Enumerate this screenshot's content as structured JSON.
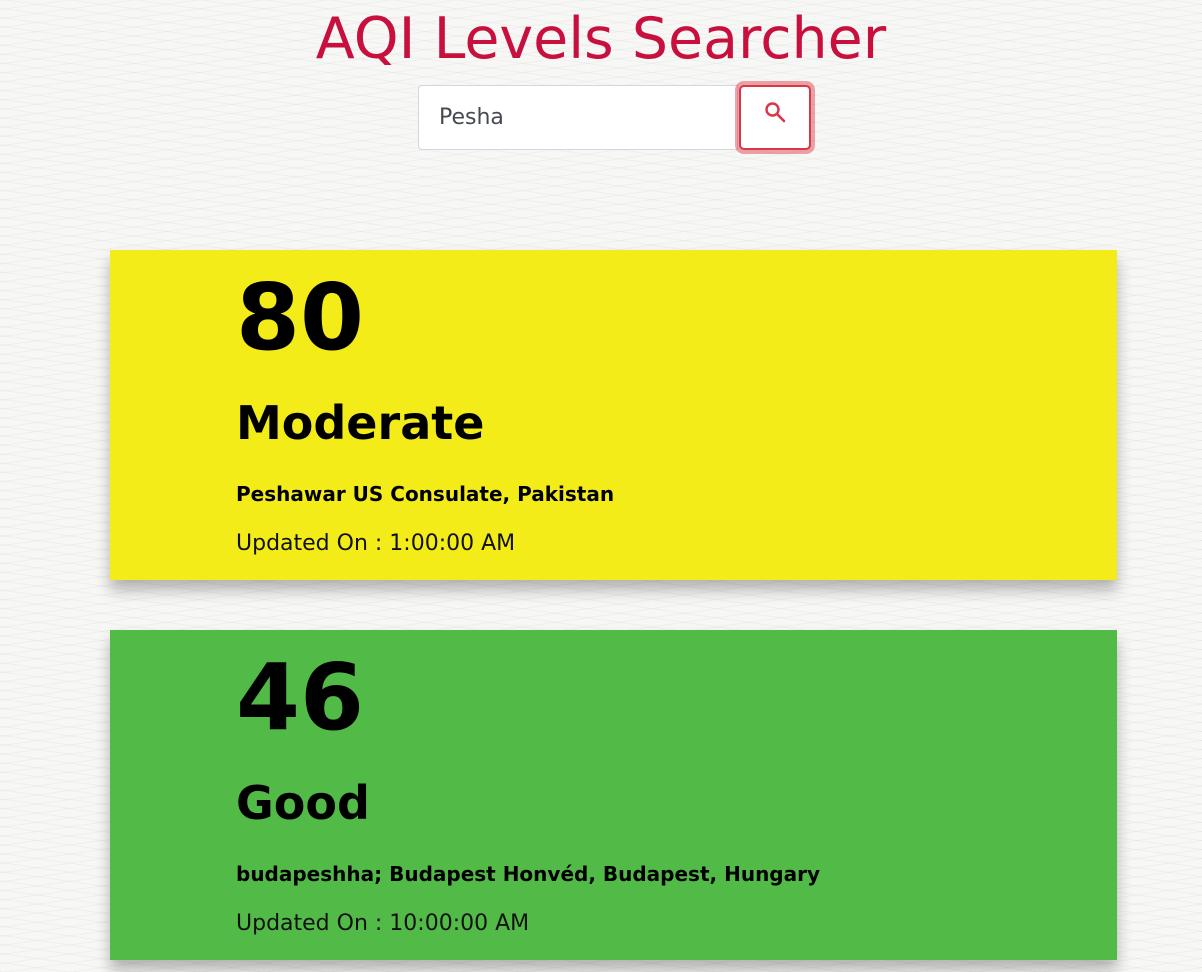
{
  "page": {
    "title": "AQI Levels Searcher",
    "title_color": "#c8103e"
  },
  "search": {
    "value": "Pesha",
    "button_icon": "search-icon",
    "accent_color": "#dc3545"
  },
  "results": [
    {
      "aqi": "80",
      "level": "Moderate",
      "station": "Peshawar US Consulate, Pakistan",
      "updated": "Updated On : 1:00:00 AM",
      "color": "#f3ec19"
    },
    {
      "aqi": "46",
      "level": "Good",
      "station": "budapeshha; Budapest Honvéd, Budapest, Hungary",
      "updated": "Updated On : 10:00:00 AM",
      "color": "#52bb48"
    }
  ]
}
